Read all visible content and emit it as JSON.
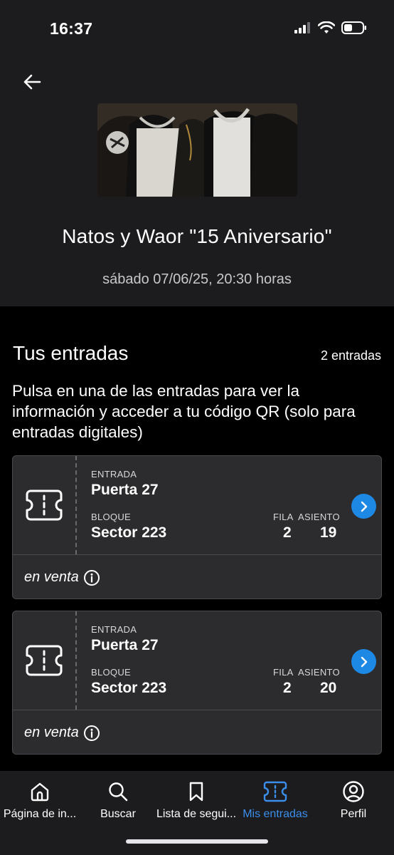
{
  "status_bar": {
    "time": "16:37"
  },
  "event": {
    "title": "Natos y Waor \"15 Aniversario\"",
    "date": "sábado 07/06/25, 20:30 horas"
  },
  "tickets_section": {
    "title": "Tus entradas",
    "count": "2 entradas",
    "hint": "Pulsa en una de las entradas para ver la información y acceder a tu código QR (solo para entradas digitales)"
  },
  "tickets": [
    {
      "entrada_label": "ENTRADA",
      "entrada": "Puerta 27",
      "bloque_label": "BLOQUE",
      "bloque": "Sector 223",
      "fila_label": "FILA",
      "fila": "2",
      "asiento_label": "ASIENTO",
      "asiento": "19",
      "status": "en venta"
    },
    {
      "entrada_label": "ENTRADA",
      "entrada": "Puerta 27",
      "bloque_label": "BLOQUE",
      "bloque": "Sector 223",
      "fila_label": "FILA",
      "fila": "2",
      "asiento_label": "ASIENTO",
      "asiento": "20",
      "status": "en venta"
    }
  ],
  "nav": [
    {
      "label": "Página de in...",
      "icon": "home-icon",
      "active": false
    },
    {
      "label": "Buscar",
      "icon": "search-icon",
      "active": false
    },
    {
      "label": "Lista de segui...",
      "icon": "bookmark-icon",
      "active": false
    },
    {
      "label": "Mis entradas",
      "icon": "ticket-icon",
      "active": true
    },
    {
      "label": "Perfil",
      "icon": "profile-icon",
      "active": false
    }
  ],
  "colors": {
    "accent": "#1e88e5",
    "active_nav": "#3b8eea",
    "card": "#2c2c2e",
    "header": "#1c1c1e"
  }
}
